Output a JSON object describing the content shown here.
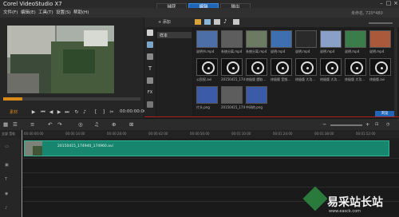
{
  "app": {
    "title": "Corel VideoStudio X7"
  },
  "steps": [
    "捕获",
    "编辑",
    "输出"
  ],
  "menu": [
    "文件(F)",
    "编辑(E)",
    "工具(T)",
    "设置(S)",
    "帮助(H)"
  ],
  "right_info": "未命名, 720*480",
  "player": {
    "timecode": "00:00:00:00",
    "mode_label": "素材"
  },
  "library": {
    "add_label": "+ 添加",
    "list_item": "样本",
    "browse_label": "浏览"
  },
  "thumbnails": [
    {
      "label": "说明书.mp4",
      "icon": "film-thumb"
    },
    {
      "label": "系统分离.mp4",
      "icon": "film-thumb"
    },
    {
      "label": "系统分离.mp4",
      "icon": "film-thumb"
    },
    {
      "label": "说明.mp4",
      "icon": "film-thumb"
    },
    {
      "label": "说明.mp4",
      "icon": "film-thumb"
    },
    {
      "label": "说明.mp4",
      "icon": "film-thumb"
    },
    {
      "label": "说明.mp4",
      "icon": "film-thumb"
    },
    {
      "label": "说明.mp4",
      "icon": "film-thumb"
    },
    {
      "label": "公民权.avi",
      "icon": "disc-thumb"
    },
    {
      "label": "20150415_174...",
      "icon": "disc-thumb"
    },
    {
      "label": "终极版 提取...",
      "icon": "disc-thumb"
    },
    {
      "label": "终极版 音频...",
      "icon": "disc-thumb"
    },
    {
      "label": "终极版 大功...",
      "icon": "disc-thumb"
    },
    {
      "label": "终极版 大功...",
      "icon": "disc-thumb"
    },
    {
      "label": "终极版 大功...",
      "icon": "disc-thumb"
    },
    {
      "label": "终极版.avi",
      "icon": "disc-thumb"
    },
    {
      "label": "片头.png",
      "icon": "image-thumb"
    },
    {
      "label": "20150415_174...",
      "icon": "film-thumb"
    },
    {
      "label": "中间的.png",
      "icon": "image-thumb"
    }
  ],
  "timeline": {
    "ruler_ticks": [
      "00:00:00:00",
      "00:00:14:00",
      "00:00:28:00",
      "00:00:42:00",
      "00:00:56:00",
      "00:01:10:00",
      "00:01:24:00",
      "00:01:38:00",
      "00:01:52:00"
    ],
    "clip_label": "20150415_174940_174960.avi",
    "track_head_label": "全部 音轨"
  },
  "watermark": {
    "text": "易采站长站",
    "sub": "www.easck.com"
  },
  "colors": {
    "accent": "#1f66b8",
    "clip": "#17866f",
    "scrub": "#d98b1a",
    "marker": "#b32020"
  }
}
